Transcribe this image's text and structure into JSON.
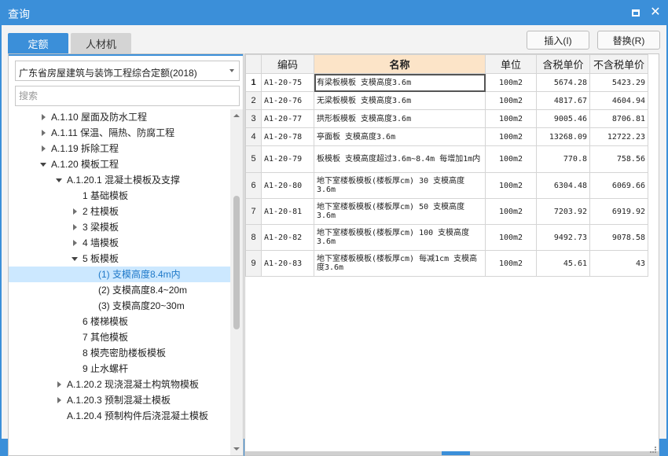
{
  "window": {
    "title": "查询"
  },
  "tabs": [
    {
      "label": "定额",
      "active": true
    },
    {
      "label": "人材机",
      "active": false
    }
  ],
  "buttons": {
    "insert": "插入(I)",
    "replace": "替换(R)"
  },
  "left": {
    "combo_value": "广东省房屋建筑与装饰工程综合定额(2018)",
    "search_placeholder": "搜索",
    "tree": [
      {
        "label": "A.1.10 屋面及防水工程",
        "level": 0,
        "toggle": "collapsed",
        "selected": false
      },
      {
        "label": "A.1.11 保温、隔热、防腐工程",
        "level": 0,
        "toggle": "collapsed",
        "selected": false
      },
      {
        "label": "A.1.19 拆除工程",
        "level": 0,
        "toggle": "collapsed",
        "selected": false
      },
      {
        "label": "A.1.20 模板工程",
        "level": 0,
        "toggle": "expanded",
        "selected": false
      },
      {
        "label": "A.1.20.1 混凝土模板及支撑",
        "level": 1,
        "toggle": "expanded",
        "selected": false
      },
      {
        "label": "1 基础模板",
        "level": 2,
        "toggle": "none",
        "selected": false
      },
      {
        "label": "2 柱模板",
        "level": 2,
        "toggle": "collapsed",
        "selected": false
      },
      {
        "label": "3 梁模板",
        "level": 2,
        "toggle": "collapsed",
        "selected": false
      },
      {
        "label": "4 墙模板",
        "level": 2,
        "toggle": "collapsed",
        "selected": false
      },
      {
        "label": "5 板模板",
        "level": 2,
        "toggle": "expanded",
        "selected": false
      },
      {
        "label": "(1) 支模高度8.4m内",
        "level": 3,
        "toggle": "none",
        "selected": true
      },
      {
        "label": "(2) 支模高度8.4~20m",
        "level": 3,
        "toggle": "none",
        "selected": false
      },
      {
        "label": "(3) 支模高度20~30m",
        "level": 3,
        "toggle": "none",
        "selected": false
      },
      {
        "label": "6 楼梯模板",
        "level": 2,
        "toggle": "none",
        "selected": false
      },
      {
        "label": "7 其他模板",
        "level": 2,
        "toggle": "none",
        "selected": false
      },
      {
        "label": "8 模壳密肋楼板模板",
        "level": 2,
        "toggle": "none",
        "selected": false
      },
      {
        "label": "9 止水螺杆",
        "level": 2,
        "toggle": "none",
        "selected": false
      },
      {
        "label": "A.1.20.2 现浇混凝土构筑物模板",
        "level": 1,
        "toggle": "collapsed",
        "selected": false
      },
      {
        "label": "A.1.20.3 预制混凝土模板",
        "level": 1,
        "toggle": "collapsed",
        "selected": false
      },
      {
        "label": "A.1.20.4 预制构件后浇混凝土模板",
        "level": 1,
        "toggle": "none",
        "selected": false
      }
    ]
  },
  "table": {
    "headers": [
      "",
      "编码",
      "名称",
      "单位",
      "含税单价",
      "不含税单价"
    ],
    "rows": [
      {
        "num": "1",
        "code": "A1-20-75",
        "name": "有梁板模板 支模高度3.6m",
        "unit": "100m2",
        "price_tax": "5674.28",
        "price_notax": "5423.29"
      },
      {
        "num": "2",
        "code": "A1-20-76",
        "name": "无梁板模板 支模高度3.6m",
        "unit": "100m2",
        "price_tax": "4817.67",
        "price_notax": "4604.94"
      },
      {
        "num": "3",
        "code": "A1-20-77",
        "name": "拱形板模板 支模高度3.6m",
        "unit": "100m2",
        "price_tax": "9005.46",
        "price_notax": "8706.81"
      },
      {
        "num": "4",
        "code": "A1-20-78",
        "name": "亭面板 支模高度3.6m",
        "unit": "100m2",
        "price_tax": "13268.09",
        "price_notax": "12722.23"
      },
      {
        "num": "5",
        "code": "A1-20-79",
        "name": "板模板 支模高度超过3.6m~8.4m 每增加1m内",
        "unit": "100m2",
        "price_tax": "770.8",
        "price_notax": "758.56"
      },
      {
        "num": "6",
        "code": "A1-20-80",
        "name": "地下室楼板模板(楼板厚cm) 30 支模高度3.6m",
        "unit": "100m2",
        "price_tax": "6304.48",
        "price_notax": "6069.66"
      },
      {
        "num": "7",
        "code": "A1-20-81",
        "name": "地下室楼板模板(楼板厚cm) 50 支模高度3.6m",
        "unit": "100m2",
        "price_tax": "7203.92",
        "price_notax": "6919.92"
      },
      {
        "num": "8",
        "code": "A1-20-82",
        "name": "地下室楼板模板(楼板厚cm) 100 支模高度3.6m",
        "unit": "100m2",
        "price_tax": "9492.73",
        "price_notax": "9078.58"
      },
      {
        "num": "9",
        "code": "A1-20-83",
        "name": "地下室楼板模板(楼板厚cm) 每减1cm 支模高度3.6m",
        "unit": "100m2",
        "price_tax": "45.61",
        "price_notax": "43"
      }
    ]
  }
}
